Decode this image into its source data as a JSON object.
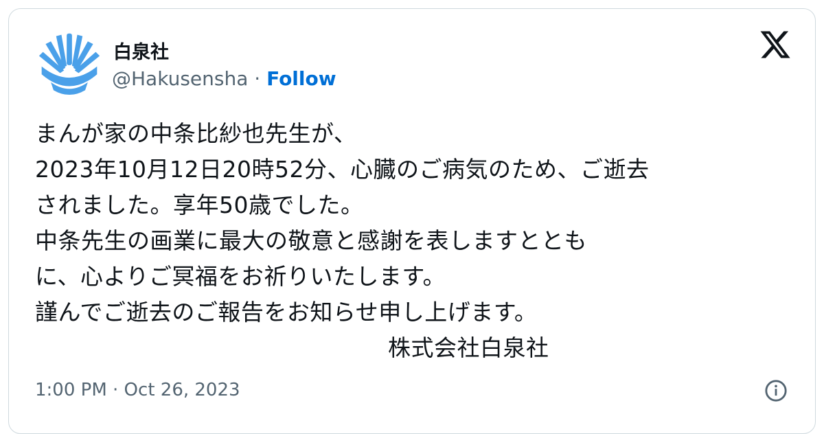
{
  "account": {
    "display_name": "白泉社",
    "handle": "@Hakusensha",
    "separator": " · ",
    "follow_label": "Follow",
    "avatar_icon": "hakusensha-logo-icon",
    "avatar_color": "#4aa0e9"
  },
  "platform": {
    "logo_icon": "x-logo-icon"
  },
  "tweet": {
    "lines": [
      "まんが家の中条比紗也先生が、",
      "2023年10月12日20時52分、心臓のご病気のため、ご逝去",
      "されました。享年50歳でした。",
      "中条先生の画業に最大の敬意と感謝を表しますととも",
      "に、心よりご冥福をお祈りいたします。",
      "謹んでご逝去のご報告をお知らせ申し上げます。"
    ],
    "signature": "株式会社白泉社"
  },
  "footer": {
    "timestamp": "1:00 PM · Oct 26, 2023",
    "info_icon": "info-icon"
  },
  "colors": {
    "text": "#0f1419",
    "secondary": "#536471",
    "follow": "#006fd6",
    "border": "#cfd9de"
  }
}
